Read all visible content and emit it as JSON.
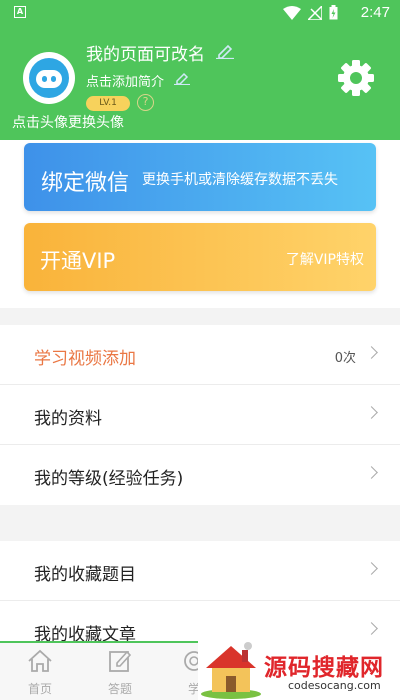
{
  "status_bar": {
    "app_icon_letter": "A",
    "time": "2:47"
  },
  "profile": {
    "nickname": "我的页面可改名",
    "intro": "点击添加简介",
    "level": "LV.1",
    "help": "?",
    "avatar_hint": "点击头像更换头像"
  },
  "cards": {
    "wechat": {
      "title": "绑定微信",
      "subtitle": "更换手机或清除缓存数据不丢失"
    },
    "vip": {
      "title": "开通VIP",
      "link": "了解VIP特权"
    }
  },
  "menu_group_1": [
    {
      "label": "学习视频添加",
      "value": "0次"
    },
    {
      "label": "我的资料"
    },
    {
      "label": "我的等级(经验任务)"
    }
  ],
  "menu_group_2": [
    {
      "label": "我的收藏题目"
    },
    {
      "label": "我的收藏文章"
    }
  ],
  "tabs": [
    {
      "label": "首页",
      "icon": "home-icon"
    },
    {
      "label": "答题",
      "icon": "edit-icon"
    },
    {
      "label": "学",
      "icon": "study-icon"
    }
  ],
  "watermark": {
    "title": "源码搜藏网",
    "url": "codesocang.com"
  },
  "colors": {
    "primary_green": "#4fc55b",
    "accent_orange": "#ea7744",
    "wechat_blue": "#3e91e9",
    "vip_gold": "#f9b33a"
  }
}
